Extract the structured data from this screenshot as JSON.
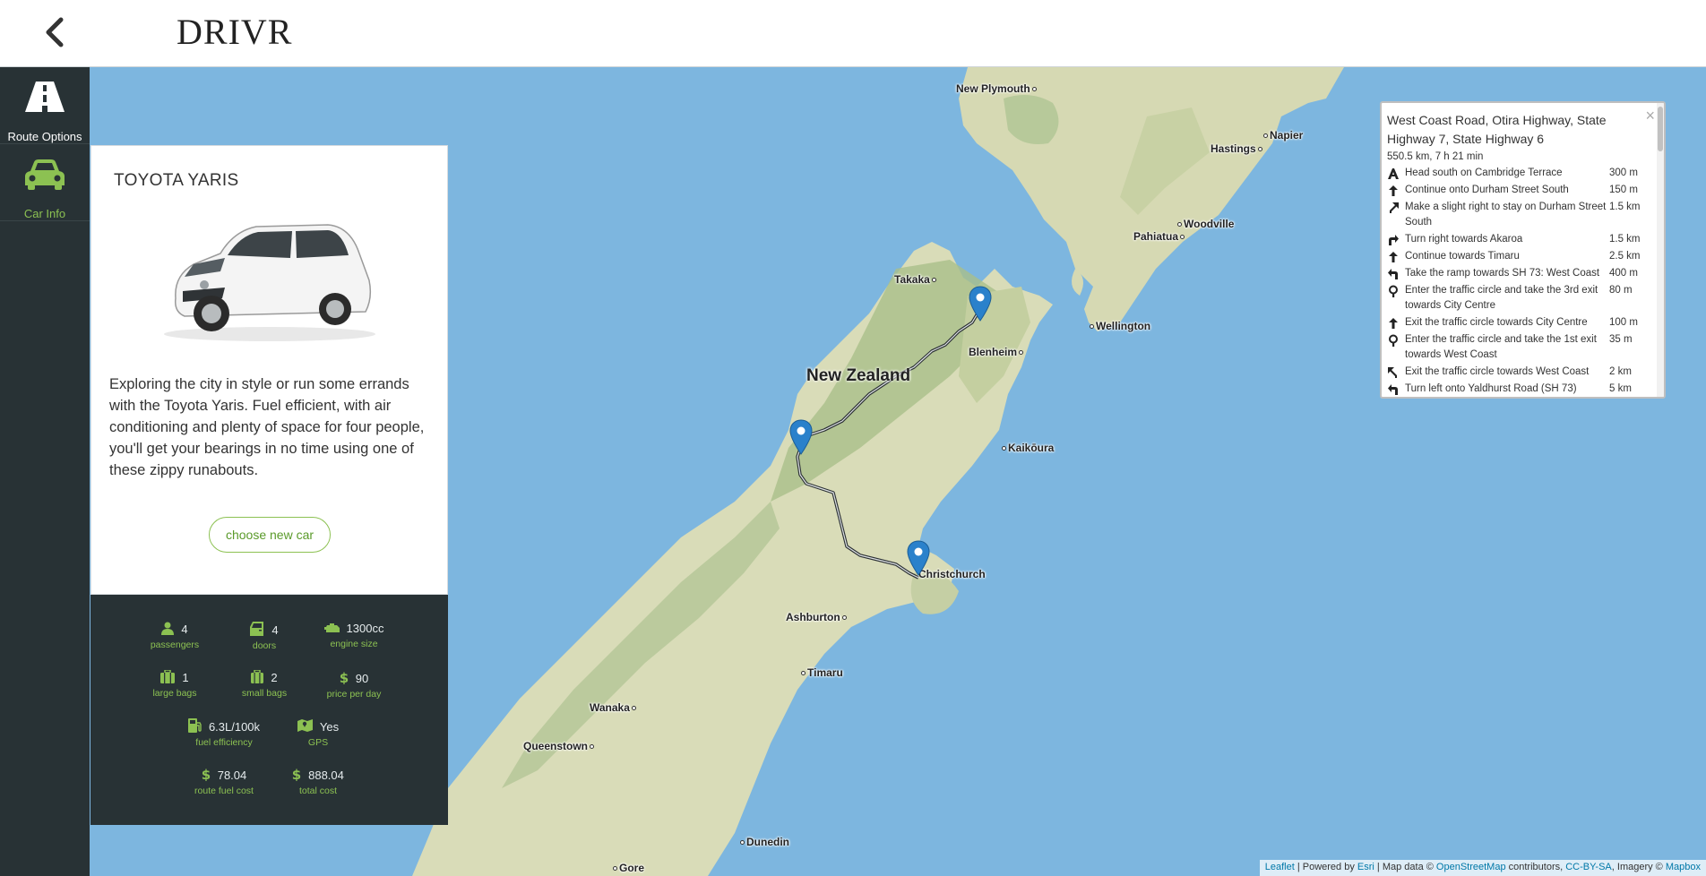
{
  "header": {
    "brand": "DRIVR"
  },
  "sidebar": {
    "items": [
      {
        "label": "Route Options",
        "color": "#ffffff"
      },
      {
        "label": "Car Info",
        "color": "#8cc152"
      }
    ]
  },
  "car": {
    "title": "TOYOTA YARIS",
    "description": "Exploring the city in style or run some errands with the Toyota Yaris. Fuel efficient, with air conditioning and plenty of space for four people, you'll get your bearings in no time using one of these zippy runabouts.",
    "choose_label": "choose new car",
    "specs": {
      "passengers": {
        "value": "4",
        "caption": "passengers",
        "icon": "person-icon"
      },
      "doors": {
        "value": "4",
        "caption": "doors",
        "icon": "door-icon"
      },
      "engine": {
        "value": "1300cc",
        "caption": "engine size",
        "icon": "engine-icon"
      },
      "large_bags": {
        "value": "1",
        "caption": "large bags",
        "icon": "suitcase-icon"
      },
      "small_bags": {
        "value": "2",
        "caption": "small bags",
        "icon": "bag-icon"
      },
      "price": {
        "value": "90",
        "caption": "price per day",
        "icon": "dollar-icon"
      },
      "fuel": {
        "value": "6.3L/100k",
        "caption": "fuel efficiency",
        "icon": "fuel-icon"
      },
      "gps": {
        "value": "Yes",
        "caption": "GPS",
        "icon": "map-icon"
      },
      "route_fuel": {
        "value": "78.04",
        "caption": "route fuel cost",
        "icon": "dollar-icon"
      },
      "total": {
        "value": "888.04",
        "caption": "total cost",
        "icon": "dollar-icon"
      }
    }
  },
  "route": {
    "name": "West Coast Road, Otira Highway, State Highway 7, State Highway 6",
    "summary": "550.5 km, 7 h 21 min",
    "close": "×",
    "steps": [
      {
        "text": "Head south on Cambridge Terrace",
        "dist": "300 m",
        "icon": "depart-icon"
      },
      {
        "text": "Continue onto Durham Street South",
        "dist": "150 m",
        "icon": "straight-icon"
      },
      {
        "text": "Make a slight right to stay on Durham Street South",
        "dist": "1.5 km",
        "icon": "slight-right-icon"
      },
      {
        "text": "Turn right towards Akaroa",
        "dist": "1.5 km",
        "icon": "turn-right-icon"
      },
      {
        "text": "Continue towards Timaru",
        "dist": "2.5 km",
        "icon": "straight-icon"
      },
      {
        "text": "Take the ramp towards SH 73: West Coast",
        "dist": "400 m",
        "icon": "ramp-left-icon"
      },
      {
        "text": "Enter the traffic circle and take the 3rd exit towards City Centre",
        "dist": "80 m",
        "icon": "roundabout-icon"
      },
      {
        "text": "Exit the traffic circle towards City Centre",
        "dist": "100 m",
        "icon": "straight-icon"
      },
      {
        "text": "Enter the traffic circle and take the 1st exit towards West Coast",
        "dist": "35 m",
        "icon": "roundabout-icon"
      },
      {
        "text": "Exit the traffic circle towards West Coast",
        "dist": "2 km",
        "icon": "slight-left-icon"
      },
      {
        "text": "Turn left onto Yaldhurst Road (SH 73)",
        "dist": "5 km",
        "icon": "turn-left-icon"
      }
    ]
  },
  "map": {
    "region_label": "New Zealand",
    "towns": [
      "New Plymouth",
      "Napier",
      "Hastings",
      "Woodville",
      "Pahiatua",
      "Wellington",
      "Takaka",
      "Blenheim",
      "Kaikōura",
      "Christchurch",
      "Ashburton",
      "Timaru",
      "Wanaka",
      "Queenstown",
      "Dunedin",
      "Gore"
    ],
    "attribution": {
      "leaflet": "Leaflet",
      "powered": " | Powered by ",
      "esri": "Esri",
      "mapdata": " | Map data © ",
      "osm": "OpenStreetMap",
      "contrib": " contributors, ",
      "license": "CC-BY-SA",
      "imagery": ", Imagery © ",
      "mapbox": "Mapbox"
    },
    "water_color": "#7db6df",
    "land_color": "#d9dcb8",
    "marker_color": "#2a81cb"
  }
}
